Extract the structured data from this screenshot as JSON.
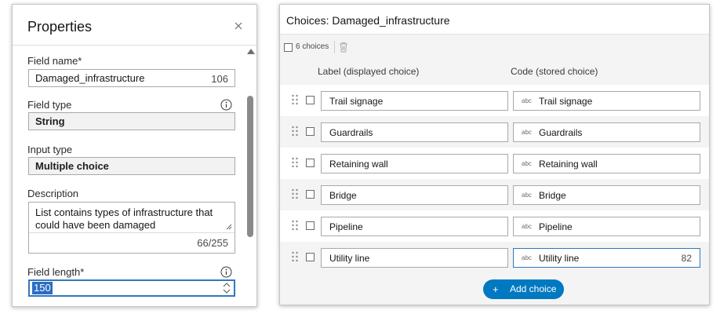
{
  "properties": {
    "title": "Properties",
    "field_name": {
      "label": "Field name*",
      "value": "Damaged_infrastructure",
      "counter": "106"
    },
    "field_type": {
      "label": "Field type",
      "value": "String"
    },
    "input_type": {
      "label": "Input type",
      "value": "Multiple choice"
    },
    "description": {
      "label": "Description",
      "value": "List contains types of infrastructure that could have been damaged",
      "counter": "66/255"
    },
    "field_length": {
      "label": "Field length*",
      "value": "150"
    }
  },
  "choices": {
    "title": "Choices: Damaged_infrastructure",
    "count_label": "6 choices",
    "columns": {
      "label": "Label (displayed choice)",
      "code": "Code (stored choice)"
    },
    "code_prefix": "abc",
    "items": [
      {
        "label": "Trail signage",
        "code": "Trail signage"
      },
      {
        "label": "Guardrails",
        "code": "Guardrails"
      },
      {
        "label": "Retaining wall",
        "code": "Retaining wall"
      },
      {
        "label": "Bridge",
        "code": "Bridge"
      },
      {
        "label": "Pipeline",
        "code": "Pipeline"
      },
      {
        "label": "Utility line",
        "code": "Utility line",
        "counter": "82"
      }
    ],
    "add_button": "Add choice",
    "add_icon": "+"
  },
  "icons": {
    "close": "close-icon",
    "info": "info-icon",
    "trash": "trash-icon",
    "drag": "drag-handle-icon",
    "spinner": "spinner-arrows-icon"
  },
  "colors": {
    "accent": "#0079c1",
    "focus_border": "#2f79bf",
    "selection": "#2b6dc2",
    "panel_background": "#f4f4f4"
  }
}
